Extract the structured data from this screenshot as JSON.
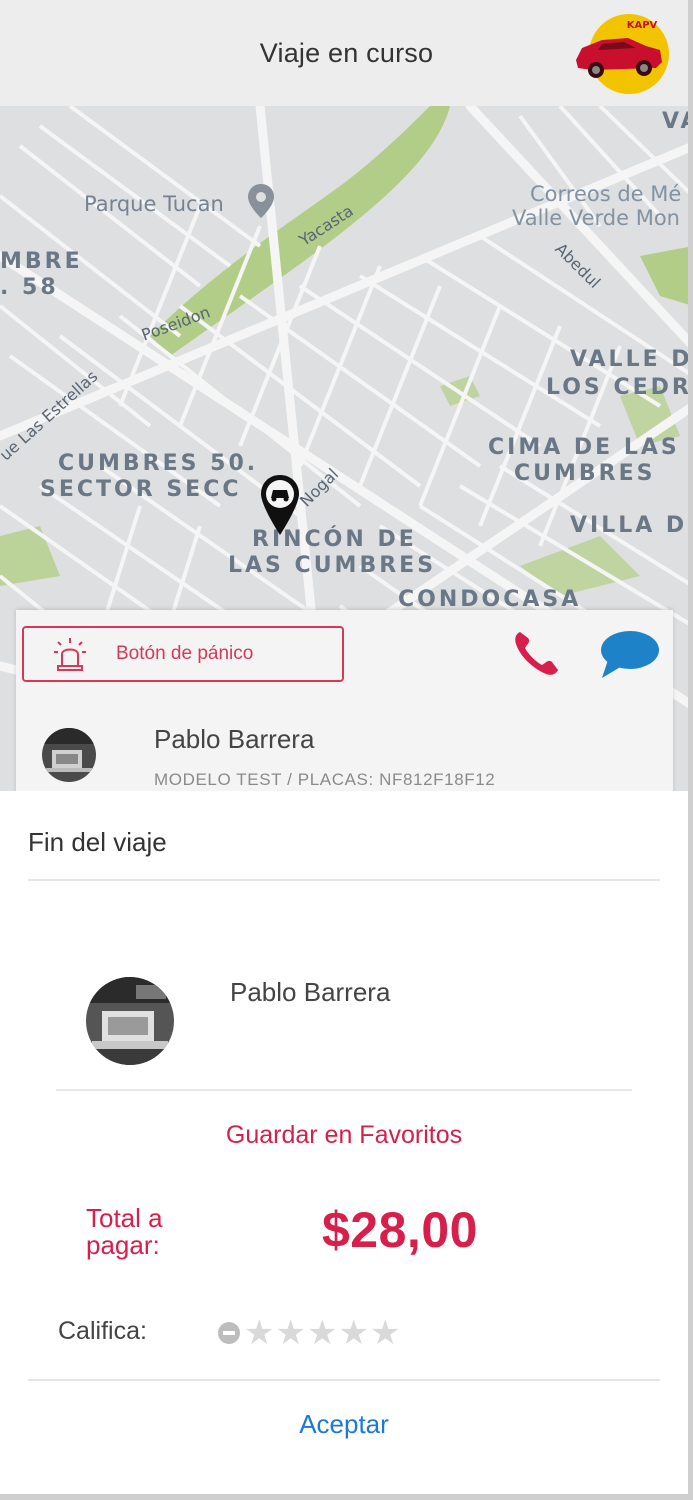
{
  "header": {
    "title": "Viaje en curso",
    "logo_text": "KAPV",
    "logo_colors": {
      "circle": "#f2c400",
      "car": "#c8102e"
    }
  },
  "map": {
    "area_labels": [
      {
        "text": "MBRE"
      },
      {
        "text": ". 58"
      },
      {
        "text": "VALLE D"
      },
      {
        "text": "LOS CEDR"
      },
      {
        "text": "CIMA DE LAS"
      },
      {
        "text": "CUMBRES"
      },
      {
        "text": "CUMBRES 50."
      },
      {
        "text": "SECTOR SECC"
      },
      {
        "text": "VILLA D"
      },
      {
        "text": "RINCÓN DE"
      },
      {
        "text": "LAS CUMBRES"
      },
      {
        "text": "CONDOCASA"
      },
      {
        "text": "VA"
      }
    ],
    "poi_labels": [
      {
        "text": "Parque Tucan"
      },
      {
        "text": "Correos de Mé"
      },
      {
        "text": "Valle Verde Mon"
      }
    ],
    "street_labels": [
      {
        "text": "Yacasta"
      },
      {
        "text": "Abedul"
      },
      {
        "text": "Poseidon"
      },
      {
        "text": "ue Las Estrellas"
      },
      {
        "text": "Nogal"
      }
    ],
    "colors": {
      "background": "#e8e9ea",
      "park": "#b9d68d",
      "street": "#ffffff"
    }
  },
  "driver_card": {
    "panic_label": "Botón de pánico",
    "driver_name": "Pablo Barrera",
    "vehicle_info": "MODELO TEST / PLACAS: NF812F18F12"
  },
  "trip_end": {
    "title": "Fin del viaje",
    "driver_name": "Pablo Barrera",
    "favorite_label": "Guardar en Favoritos",
    "total_label": "Total a pagar:",
    "total_value": "$28,00",
    "rate_label": "Califica:",
    "rating": {
      "value": 0,
      "max": 5
    },
    "accept_label": "Aceptar",
    "colors": {
      "accent": "#d6204b",
      "link": "#1e78d6"
    }
  }
}
